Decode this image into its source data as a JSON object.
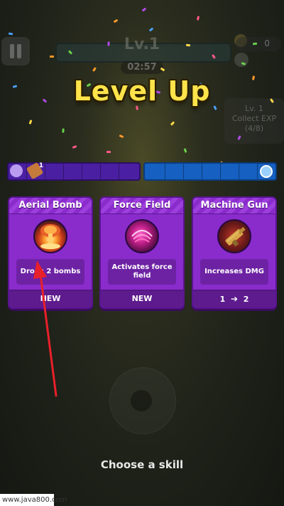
{
  "hud": {
    "level": "Lv.1",
    "timer": "02:57",
    "kill_count": "0",
    "quest_lines": [
      "Lv. 1",
      "Collect EXP",
      "(4/8)"
    ]
  },
  "title": "Level Up",
  "slots": {
    "left_items": [
      {
        "icon": "wing-icon",
        "color": "#b99cf0",
        "count": ""
      },
      {
        "icon": "missile-icon",
        "color": "#c47a3a",
        "count": "1"
      }
    ],
    "right_items": [
      {
        "icon": "clock-icon",
        "color": "#9ad0ff",
        "count": ""
      }
    ]
  },
  "cards": [
    {
      "name": "Aerial Bomb",
      "description": "Drops 2 bombs",
      "footer": "NEW",
      "icon": "explosion-icon"
    },
    {
      "name": "Force Field",
      "description": "Activates force field",
      "footer": "NEW",
      "icon": "vortex-icon"
    },
    {
      "name": "Machine Gun",
      "description": "Increases DMG",
      "footer_from": "1",
      "footer_to": "2",
      "footer_arrow": "➔",
      "icon": "machine-gun-icon"
    }
  ],
  "prompt": "Choose a skill",
  "watermark": "www.java800.com",
  "colors": {
    "title": "#ffe34a",
    "card_bg": "#8a2ccc",
    "left_bar": "#4b1fa2",
    "right_bar": "#1560c0",
    "annotation_arrow": "#e8202a"
  }
}
